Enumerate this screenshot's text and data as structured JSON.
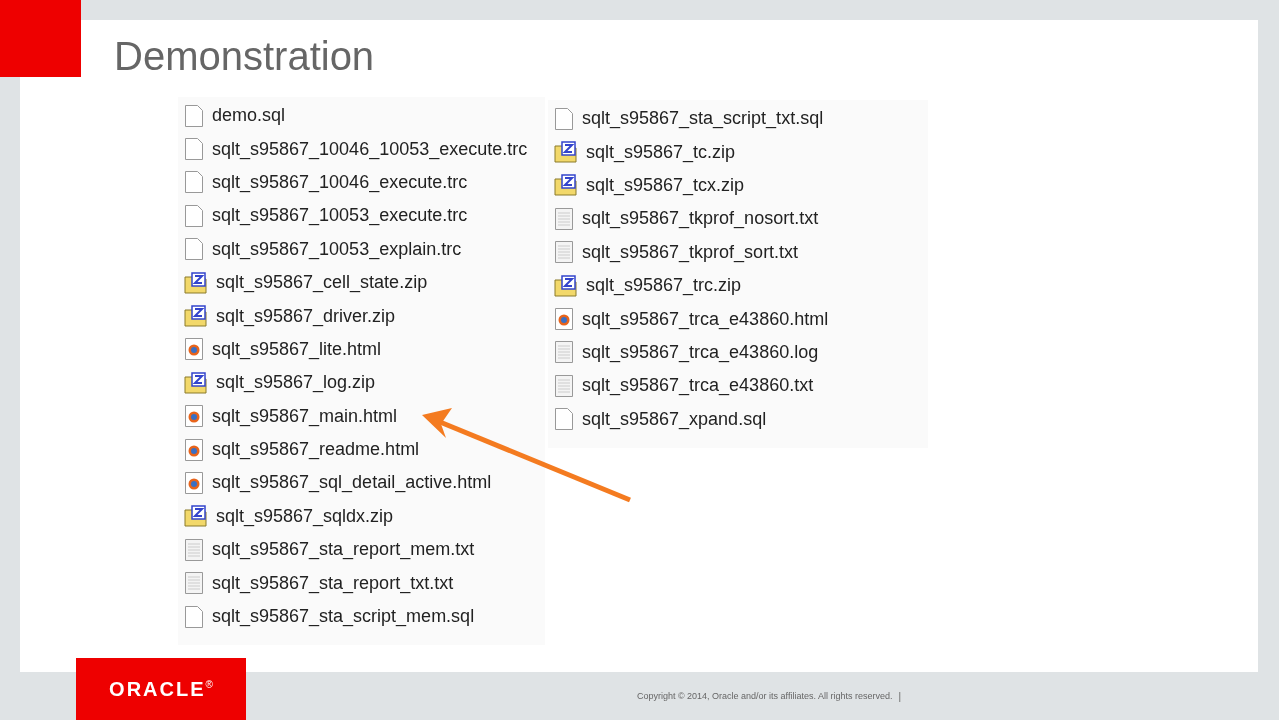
{
  "slide": {
    "title": "Demonstration"
  },
  "file_columns": [
    {
      "files": [
        {
          "name": "demo.sql",
          "kind": "blank"
        },
        {
          "name": "sqlt_s95867_10046_10053_execute.trc",
          "kind": "blank"
        },
        {
          "name": "sqlt_s95867_10046_execute.trc",
          "kind": "blank"
        },
        {
          "name": "sqlt_s95867_10053_execute.trc",
          "kind": "blank"
        },
        {
          "name": "sqlt_s95867_10053_explain.trc",
          "kind": "blank"
        },
        {
          "name": "sqlt_s95867_cell_state.zip",
          "kind": "zip"
        },
        {
          "name": "sqlt_s95867_driver.zip",
          "kind": "zip"
        },
        {
          "name": "sqlt_s95867_lite.html",
          "kind": "html"
        },
        {
          "name": "sqlt_s95867_log.zip",
          "kind": "zip"
        },
        {
          "name": "sqlt_s95867_main.html",
          "kind": "html"
        },
        {
          "name": "sqlt_s95867_readme.html",
          "kind": "html"
        },
        {
          "name": "sqlt_s95867_sql_detail_active.html",
          "kind": "html"
        },
        {
          "name": "sqlt_s95867_sqldx.zip",
          "kind": "zip"
        },
        {
          "name": "sqlt_s95867_sta_report_mem.txt",
          "kind": "text"
        },
        {
          "name": "sqlt_s95867_sta_report_txt.txt",
          "kind": "text"
        },
        {
          "name": "sqlt_s95867_sta_script_mem.sql",
          "kind": "blank"
        }
      ]
    },
    {
      "files": [
        {
          "name": "sqlt_s95867_sta_script_txt.sql",
          "kind": "blank"
        },
        {
          "name": "sqlt_s95867_tc.zip",
          "kind": "zip"
        },
        {
          "name": "sqlt_s95867_tcx.zip",
          "kind": "zip"
        },
        {
          "name": "sqlt_s95867_tkprof_nosort.txt",
          "kind": "text"
        },
        {
          "name": "sqlt_s95867_tkprof_sort.txt",
          "kind": "text"
        },
        {
          "name": "sqlt_s95867_trc.zip",
          "kind": "zip"
        },
        {
          "name": "sqlt_s95867_trca_e43860.html",
          "kind": "html"
        },
        {
          "name": "sqlt_s95867_trca_e43860.log",
          "kind": "text"
        },
        {
          "name": "sqlt_s95867_trca_e43860.txt",
          "kind": "text"
        },
        {
          "name": "sqlt_s95867_xpand.sql",
          "kind": "blank"
        }
      ]
    }
  ],
  "footer": {
    "logo": "ORACLE",
    "registered": "®",
    "copyright": "Copyright © 2014, Oracle and/or its affiliates. All rights reserved.",
    "separator": "|"
  }
}
